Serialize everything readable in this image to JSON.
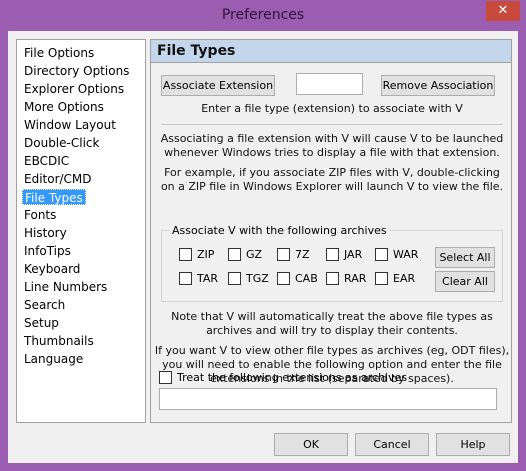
{
  "window": {
    "title": "Preferences",
    "close_glyph": "✕"
  },
  "nav": {
    "items": [
      "File Options",
      "Directory Options",
      "Explorer Options",
      "More Options",
      "Window Layout",
      "Double-Click",
      "EBCDIC",
      "Editor/CMD",
      "File Types",
      "Fonts",
      "History",
      "InfoTips",
      "Keyboard",
      "Line Numbers",
      "Search",
      "Setup",
      "Thumbnails",
      "Language"
    ],
    "selected": "File Types"
  },
  "panel": {
    "title": "File Types",
    "associate_button": "Associate Extension",
    "extension_value": "",
    "remove_button": "Remove Association",
    "instruction": "Enter a file type (extension) to associate with V",
    "para1": [
      "Associating a file extension with V will cause V to be launched",
      "whenever Windows tries to display a file with that extension."
    ],
    "para2": [
      "For example, if you associate ZIP files with V, double-clicking",
      "on a ZIP file in Windows Explorer will launch V to view the file."
    ],
    "archives_group_label": "Associate V with the following archives",
    "archives_row1": [
      "ZIP",
      "GZ",
      "7Z",
      "JAR",
      "WAR"
    ],
    "archives_row2": [
      "TAR",
      "TGZ",
      "CAB",
      "RAR",
      "EAR"
    ],
    "select_all": "Select All",
    "clear_all": "Clear All",
    "note": [
      "Note that V will automatically treat the above file types as",
      "archives and will try to display their contents."
    ],
    "note2": [
      "If you want V to view other file types as archives (eg, ODT files),",
      "you will need to enable the following option and enter the file",
      "extensions in the list (separated by spaces)."
    ],
    "treat_checkbox_label": "Treat the following extensions as archives",
    "extensions_value": ""
  },
  "footer": {
    "ok": "OK",
    "cancel": "Cancel",
    "help": "Help"
  }
}
